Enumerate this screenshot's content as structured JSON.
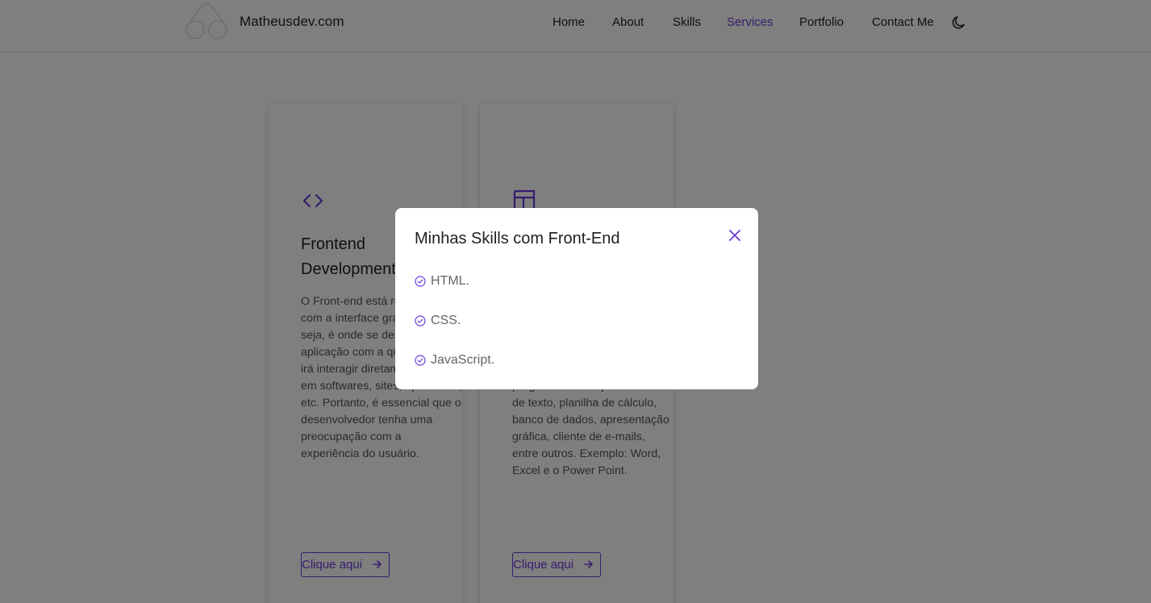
{
  "header": {
    "brand": "Matheusdev.com",
    "nav": [
      {
        "label": "Home"
      },
      {
        "label": "About"
      },
      {
        "label": "Skills"
      },
      {
        "label": "Services"
      },
      {
        "label": "Portfolio"
      },
      {
        "label": "Contact Me"
      }
    ],
    "active": "Services",
    "theme_icon": "moon-icon"
  },
  "cards": [
    {
      "icon": "code-brackets-icon",
      "title": "Frontend\nDevelopment",
      "text": "O Front-end está relacionado com a interface gráfica. Ou seja, é onde se desenvolve a aplicação com a qual o usuário irá interagir diretamente, seja em softwares, sites, aplicativos, etc. Portanto, é essencial que o desenvolvedor tenha uma preocupação com a experiência do usuário.",
      "button": "Clique aqui"
    },
    {
      "icon": "layout-icon",
      "title": "",
      "text": "programas como processador de texto, planilha de cálculo, banco de dados, apresentação gráfica, cliente de e-mails, entre outros. Exemplo: Word, Excel e o Power Point.",
      "button": "Clique aqui"
    }
  ],
  "modal": {
    "title": "Minhas Skills com Front-End",
    "items": [
      "HTML.",
      "CSS.",
      "JavaScript."
    ]
  },
  "colors": {
    "accent": "#6a3bd8",
    "overlay": "rgba(0,0,0,0.5)"
  }
}
